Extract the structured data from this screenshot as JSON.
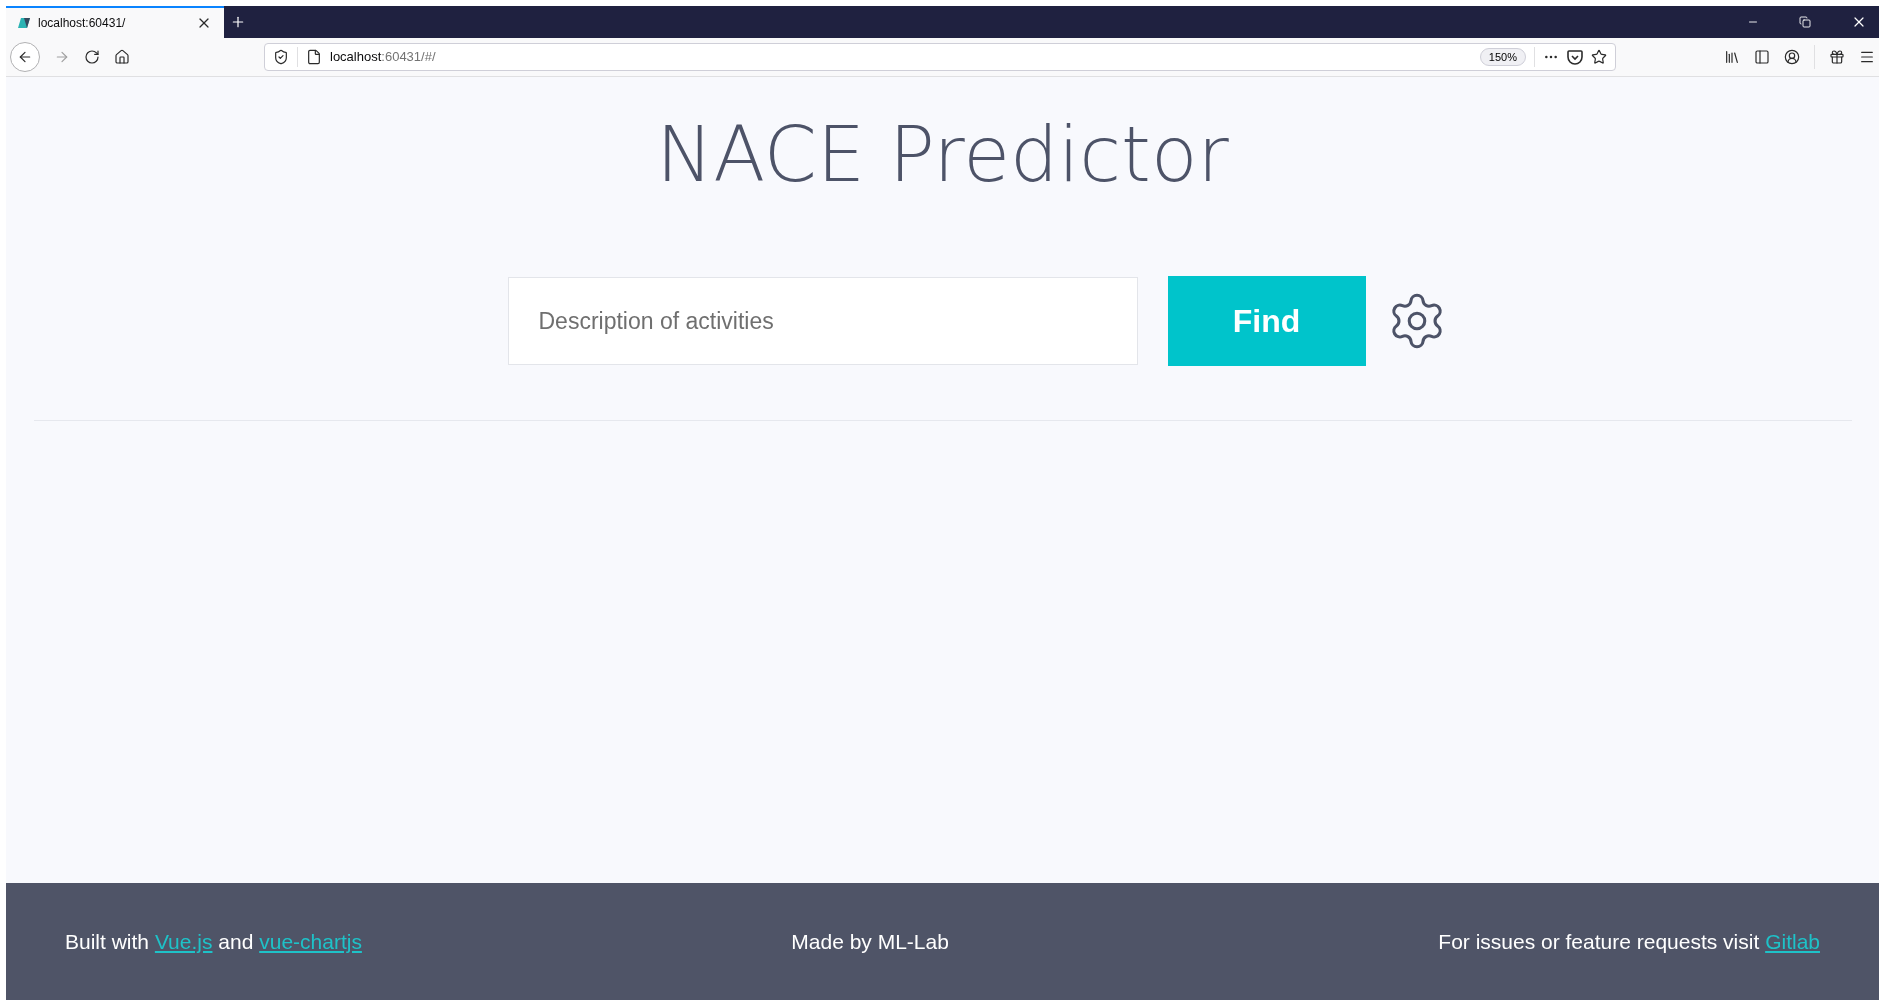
{
  "browser": {
    "tab": {
      "title": "localhost:60431/",
      "selected": true
    },
    "url": {
      "host": "localhost",
      "rest": ":60431/#/"
    },
    "zoom": "150%"
  },
  "page": {
    "title": "NACE Predictor",
    "search": {
      "placeholder": "Description of activities"
    },
    "find_button": "Find"
  },
  "footer": {
    "left": {
      "text_1": "Built with",
      "link_1": "Vue.js",
      "text_2": "and",
      "link_2": "vue-chartjs"
    },
    "center": "Made by ML-Lab",
    "right": {
      "text": "For issues or feature requests visit",
      "link": "Gitlab"
    }
  }
}
